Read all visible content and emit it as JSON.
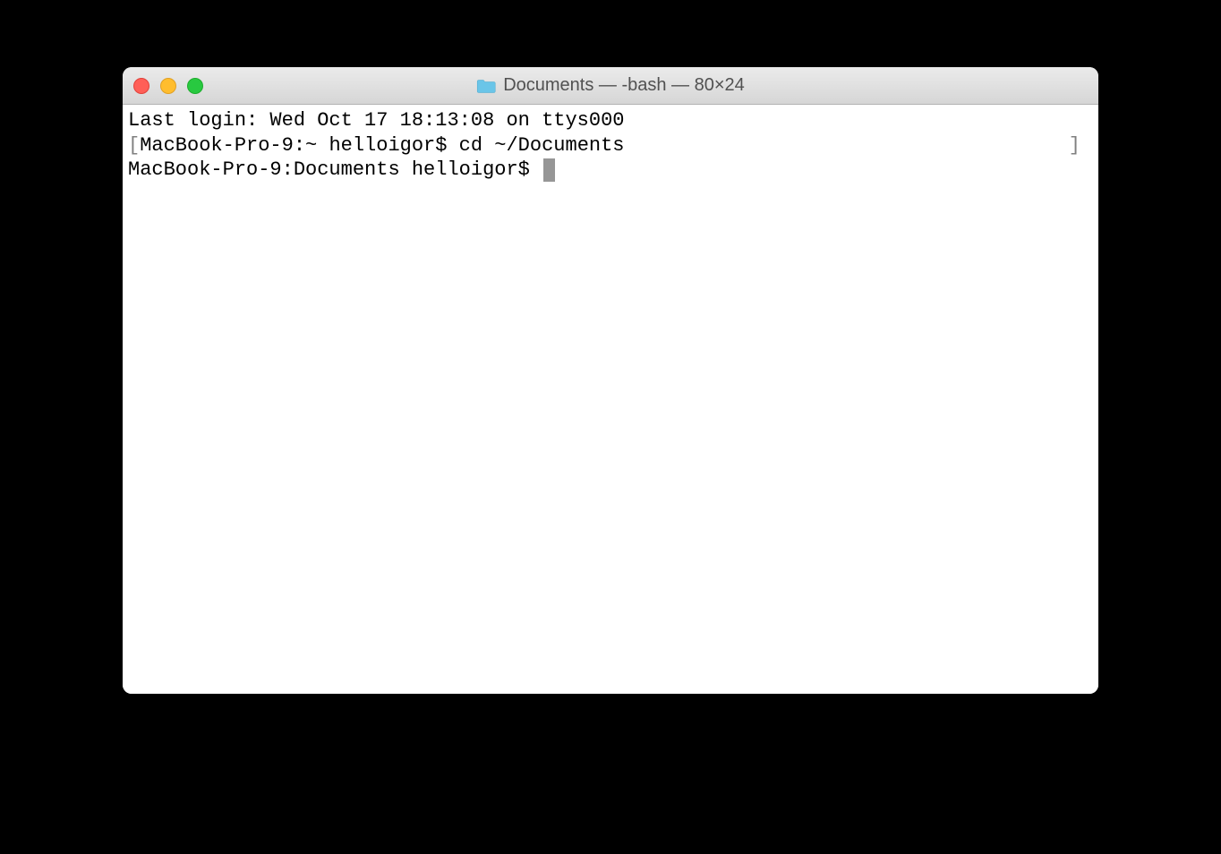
{
  "titlebar": {
    "title": "Documents — -bash — 80×24",
    "folder_icon": "folder-icon"
  },
  "terminal": {
    "lines": [
      {
        "text": "Last login: Wed Oct 17 18:13:08 on ttys000",
        "bracket": false
      },
      {
        "prompt": "MacBook-Pro-9:~ helloigor$ ",
        "command": "cd ~/Documents",
        "bracket": true
      },
      {
        "prompt": "MacBook-Pro-9:Documents helloigor$ ",
        "cursor": true,
        "bracket": false
      }
    ]
  }
}
